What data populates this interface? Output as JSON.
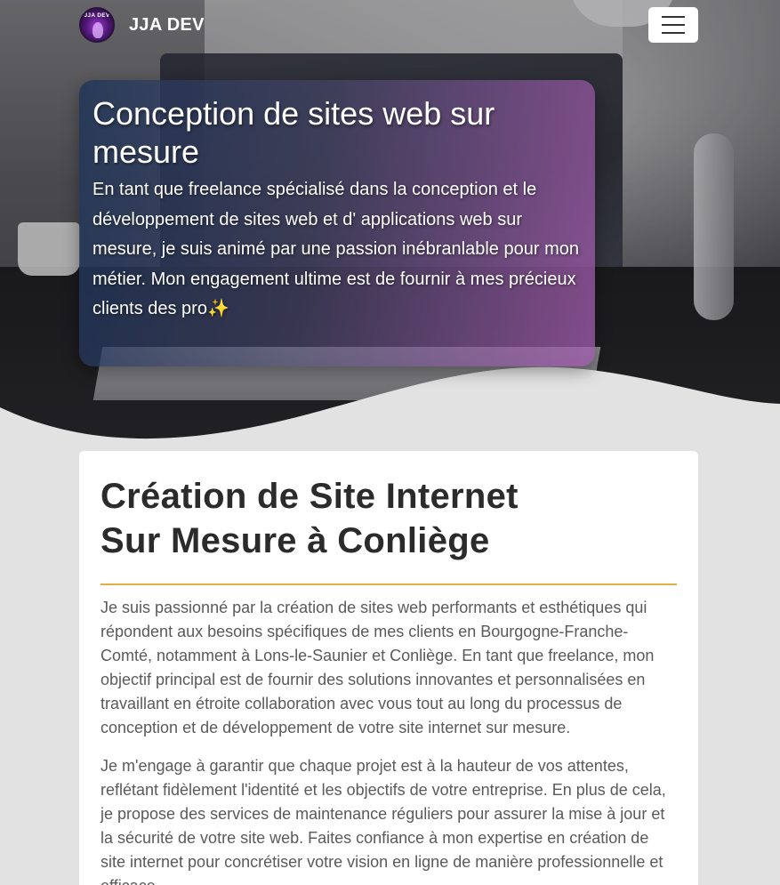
{
  "navbar": {
    "logo_text": "JJA DEV",
    "brand_name": "JJA DEV",
    "menu_icon": "hamburger-menu-icon"
  },
  "hero": {
    "title": "Conception de sites web sur mesure",
    "text": "En tant que freelance spécialisé dans la conception et le développement de sites web et d' applications web sur mesure, je suis animé par une passion inébranlable pour mon métier. Mon engagement ultime est de fournir à mes précieux clients des pro",
    "emoji": "✨"
  },
  "content": {
    "title_line1": "Création de Site Internet",
    "title_line2": "Sur Mesure à Conliège",
    "paragraph1": "Je suis passionné par la création de sites web performants et esthétiques qui répondent aux besoins spécifiques de mes clients en Bourgogne-Franche-Comté, notamment à Lons-le-Saunier et Conliège. En tant que freelance, mon objectif principal est de fournir des solutions innovantes et personnalisées en travaillant en étroite collaboration avec vous tout au long du processus de conception et de développement de votre site internet sur mesure.",
    "paragraph2": "Je m'engage à garantir que chaque projet est à la hauteur de vos attentes, reflétant fidèlement l'identité et les objectifs de votre entreprise. En plus de cela, je propose des services de maintenance réguliers pour assurer la mise à jour et la sécurité de votre site web. Faites confiance à mon expertise en création de site internet pour concrétiser votre vision en ligne de manière professionnelle et efficace."
  },
  "colors": {
    "accent_divider": "#e2ae45",
    "page_background": "#e2e2e2",
    "title_text": "#2b2b2b",
    "body_text": "#5a5a5a"
  }
}
